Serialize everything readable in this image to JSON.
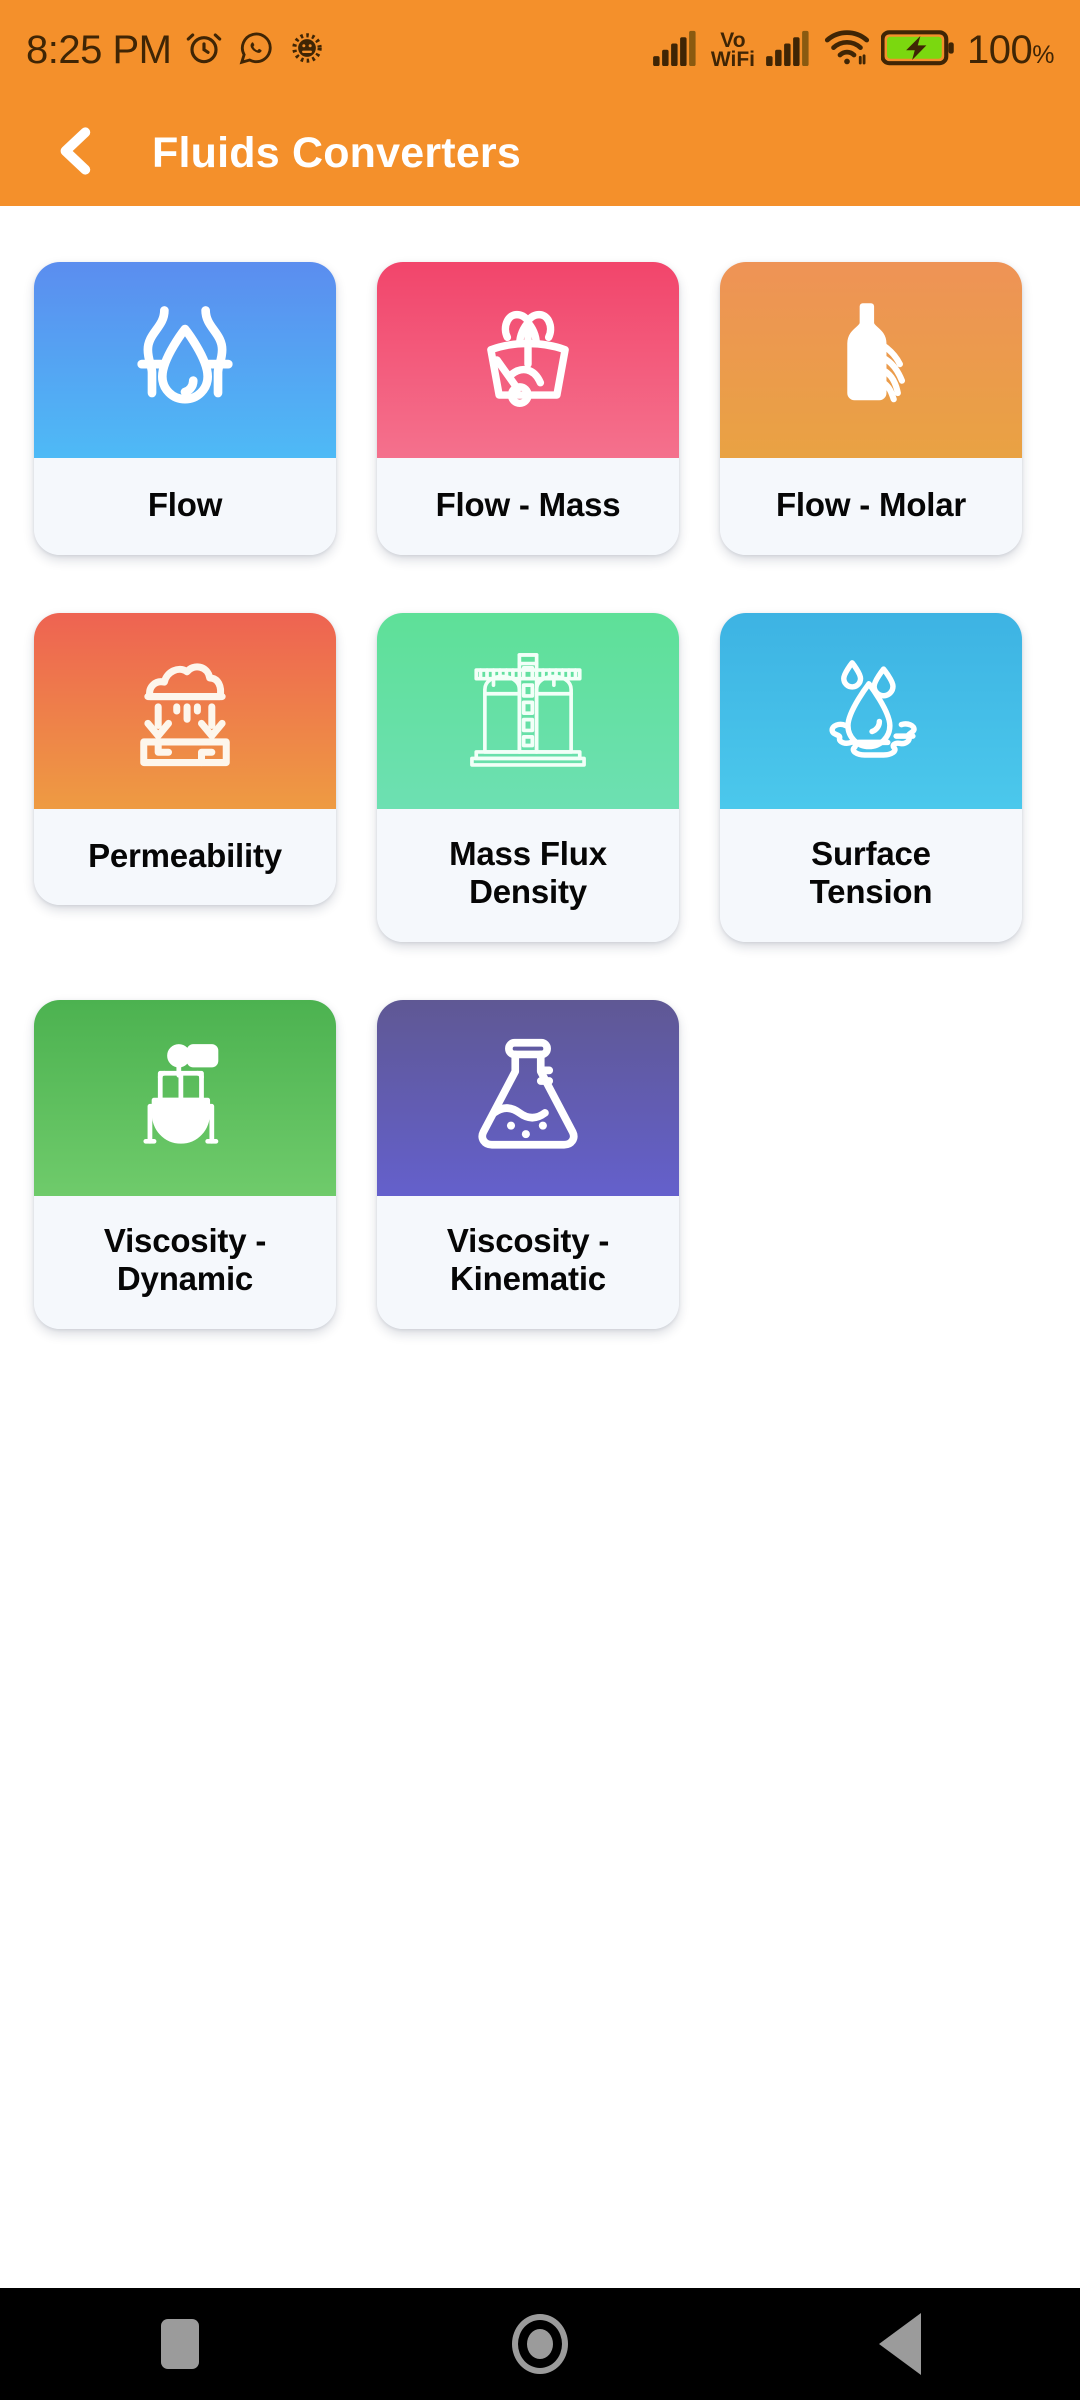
{
  "status_bar": {
    "time": "8:25 PM",
    "left_icons": [
      "alarm-clock-icon",
      "whatsapp-icon",
      "settings-gear-icon"
    ],
    "vowifi_line1": "Vo",
    "vowifi_line2": "WiFi",
    "right_icons": [
      "signal-bars-icon",
      "vowifi-label",
      "signal-bars-icon-2",
      "wifi-icon",
      "battery-charging-icon"
    ],
    "battery_percent": "100",
    "percent_symbol": "%",
    "bar_color": "#F4902B",
    "text_color": "#3F2505",
    "battery_fill_color": "#7BD80F"
  },
  "app_bar": {
    "title": "Fluids Converters",
    "back_icon": "chevron-left-icon",
    "background": "#F4902B",
    "title_color": "#FFFFFF"
  },
  "grid": {
    "rows": [
      [
        {
          "label": "Flow",
          "icon": "water-drop-pipe-icon",
          "gradient_from": "#5B8DEF",
          "gradient_to": "#4EBAF6",
          "lines": 1
        },
        {
          "label": "Flow - Mass",
          "icon": "fountain-spray-icon",
          "gradient_from": "#F2456B",
          "gradient_to": "#F4718D",
          "lines": 1
        },
        {
          "label": "Flow - Molar",
          "icon": "bottle-pouring-icon",
          "gradient_from": "#EE9356",
          "gradient_to": "#E9A243",
          "lines": 1
        }
      ],
      [
        {
          "label": "Permeability",
          "icon": "cloud-rain-soil-icon",
          "gradient_from": "#EE6352",
          "gradient_to": "#EE9B42",
          "lines": 1
        },
        {
          "label": "Mass Flux Density",
          "label_line1": "Mass Flux",
          "label_line2": "Density",
          "icon": "storage-tanks-icon",
          "gradient_from": "#5EE098",
          "gradient_to": "#6DE0B2",
          "lines": 2
        },
        {
          "label": "Surface Tension",
          "label_line1": "Surface",
          "label_line2": "Tension",
          "icon": "droplet-puddle-icon",
          "gradient_from": "#3DB3E3",
          "gradient_to": "#4BC8EC",
          "lines": 2
        }
      ],
      [
        {
          "label": "Viscosity - Dynamic",
          "label_line1": "Viscosity -",
          "label_line2": "Dynamic",
          "icon": "mixer-vessel-icon",
          "gradient_from": "#4CB250",
          "gradient_to": "#6FCB6B",
          "lines": 2
        },
        {
          "label": "Viscosity - Kinematic",
          "label_line1": "Viscosity -",
          "label_line2": "Kinematic",
          "icon": "erlenmeyer-flask-icon",
          "gradient_from": "#5F5894",
          "gradient_to": "#6460CC",
          "lines": 2
        }
      ]
    ]
  },
  "nav_bar": {
    "background": "#000000",
    "icon_color": "#9B9B9B",
    "buttons": [
      "recents-square-button",
      "home-circle-button",
      "back-triangle-button"
    ]
  }
}
